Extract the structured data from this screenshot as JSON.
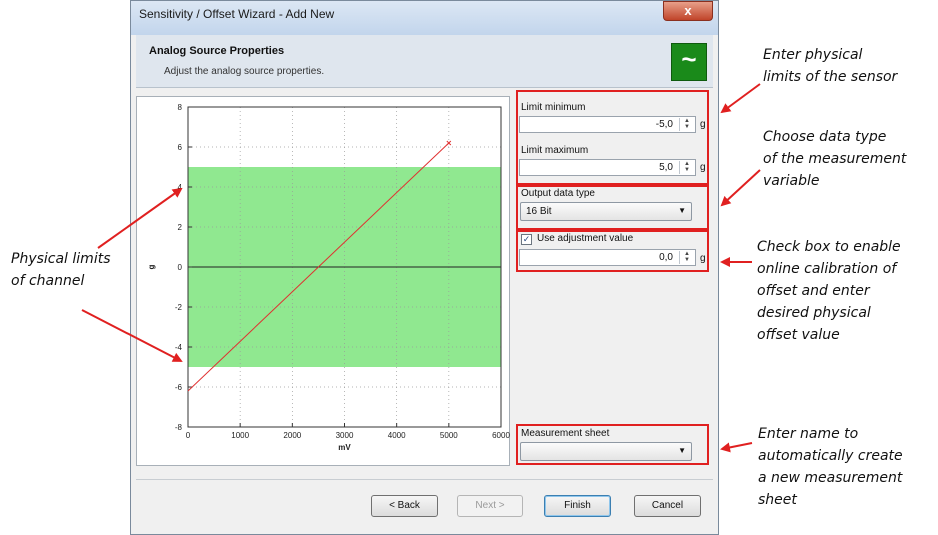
{
  "window": {
    "title": "Sensitivity / Offset Wizard - Add New",
    "close_label": "x"
  },
  "header": {
    "title": "Analog Source Properties",
    "subtitle": "Adjust the analog source properties.",
    "icon": "analog-wave-icon"
  },
  "chart_data": {
    "type": "line",
    "xlabel": "mV",
    "ylabel": "g",
    "xlim": [
      0,
      6000
    ],
    "ylim": [
      -8,
      8
    ],
    "x_ticks": [
      "0",
      "1000",
      "2000",
      "3000",
      "4000",
      "5000",
      "6000"
    ],
    "y_ticks": [
      "8",
      "6",
      "4",
      "2",
      "0",
      "-2",
      "-4",
      "-6",
      "-8"
    ],
    "band": {
      "y_min": -5,
      "y_max": 5,
      "color": "#90e890"
    },
    "grid": true,
    "series": [
      {
        "x": [
          0,
          5000
        ],
        "y": [
          -6.2,
          6.2
        ],
        "color": "#e03030"
      }
    ]
  },
  "form": {
    "limit_min": {
      "label": "Limit minimum",
      "value": "-5,0",
      "unit": "g"
    },
    "limit_max": {
      "label": "Limit maximum",
      "value": "5,0",
      "unit": "g"
    },
    "output_type": {
      "label": "Output data type",
      "value": "16 Bit"
    },
    "adjustment": {
      "label": "Use adjustment value",
      "checked": true,
      "value": "0,0",
      "unit": "g"
    },
    "sheet": {
      "label": "Measurement sheet",
      "value": ""
    }
  },
  "buttons": {
    "back": "< Back",
    "next": "Next >",
    "finish": "Finish",
    "cancel": "Cancel"
  },
  "annotations": {
    "sensor_limits": [
      "Enter physical",
      "limits of the sensor"
    ],
    "data_type": [
      "Choose data type",
      "of the measurement",
      "variable"
    ],
    "calibration": [
      "Check box to enable",
      "online calibration of",
      "offset and enter",
      "desired physical",
      "offset value"
    ],
    "sheet": [
      "Enter name to",
      "automatically create",
      "a new measurement",
      "sheet"
    ],
    "channel": [
      "Physical limits",
      "of channel"
    ]
  },
  "colors": {
    "highlight": "#e02020",
    "band": "#90e890",
    "line": "#e03030"
  }
}
